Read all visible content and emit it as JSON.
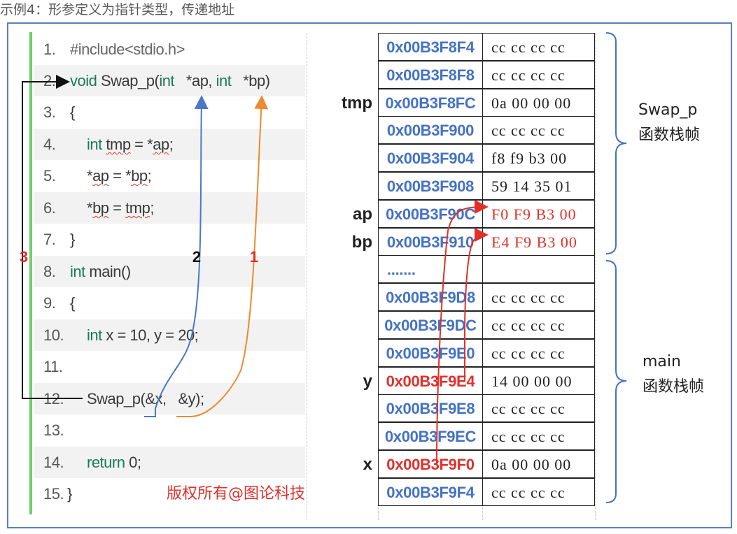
{
  "title": "示例4：形参定义为指针类型，传递地址",
  "code": [
    {
      "num": "1.",
      "text": "#include<stdio.h>"
    },
    {
      "num": "2.",
      "text": "Swap_p(int   *ap, int   *bp)",
      "prefix": "void"
    },
    {
      "num": "3.",
      "text": "{"
    },
    {
      "num": "4.",
      "text": "tmp = *ap;",
      "prefix": "int"
    },
    {
      "num": "5.",
      "text": "*ap = *bp;"
    },
    {
      "num": "6.",
      "text": "*bp = tmp;"
    },
    {
      "num": "7.",
      "text": "}"
    },
    {
      "num": "8.",
      "text": "main()",
      "prefix": "int"
    },
    {
      "num": "9.",
      "text": "{"
    },
    {
      "num": "10.",
      "text": "x = 10, y = 20;",
      "prefix": "int"
    },
    {
      "num": "11.",
      "text": ""
    },
    {
      "num": "12.",
      "text": "Swap_p(&x,   &y);"
    },
    {
      "num": "13.",
      "text": ""
    },
    {
      "num": "14.",
      "text": "return 0;"
    },
    {
      "num": "15.",
      "text": "}"
    }
  ],
  "arrow_labels": {
    "first": "1",
    "second": "2",
    "third": "3"
  },
  "copyright": "版权所有@图论科技",
  "memory": [
    {
      "label": "",
      "addr": "0x00B3F8F4",
      "value": "cc cc cc cc"
    },
    {
      "label": "",
      "addr": "0x00B3F8F8",
      "value": "cc cc cc cc"
    },
    {
      "label": "tmp",
      "addr": "0x00B3F8FC",
      "value": "0a 00 00 00"
    },
    {
      "label": "",
      "addr": "0x00B3F900",
      "value": "cc cc cc cc"
    },
    {
      "label": "",
      "addr": "0x00B3F904",
      "value": "f8 f9 b3 00"
    },
    {
      "label": "",
      "addr": "0x00B3F908",
      "value": "59 14 35 01"
    },
    {
      "label": "ap",
      "addr": "0x00B3F90C",
      "value": "F0 F9 B3 00",
      "value_red": true
    },
    {
      "label": "bp",
      "addr": "0x00B3F910",
      "value": "E4 F9 B3 00",
      "value_red": true
    },
    {
      "label": "",
      "addr": ".......",
      "value": ""
    },
    {
      "label": "",
      "addr": "0x00B3F9D8",
      "value": "cc cc cc cc"
    },
    {
      "label": "",
      "addr": "0x00B3F9DC",
      "value": "cc cc cc cc"
    },
    {
      "label": "",
      "addr": "0x00B3F9E0",
      "value": "cc cc cc cc"
    },
    {
      "label": "y",
      "addr": "0x00B3F9E4",
      "value": "14 00 00 00",
      "addr_red": true
    },
    {
      "label": "",
      "addr": "0x00B3F9E8",
      "value": "cc cc cc cc"
    },
    {
      "label": "",
      "addr": "0x00B3F9EC",
      "value": "cc cc cc cc"
    },
    {
      "label": "x",
      "addr": "0x00B3F9F0",
      "value": "0a 00 00 00",
      "addr_red": true
    },
    {
      "label": "",
      "addr": "0x00B3F9F4",
      "value": "cc cc cc cc"
    }
  ],
  "frames": {
    "swap": {
      "line1": "Swap_p",
      "line2": "函数栈帧"
    },
    "main": {
      "line1": "main",
      "line2": "函数栈帧"
    }
  },
  "colors": {
    "blue_addr": "#4472c4",
    "red": "#e0302a",
    "orange": "#ed8a2e",
    "arrow_blue": "#4a78c8",
    "border": "#5b7fbf",
    "code_bar": "#6fcf6f",
    "keyword": "#1a7a5c"
  }
}
